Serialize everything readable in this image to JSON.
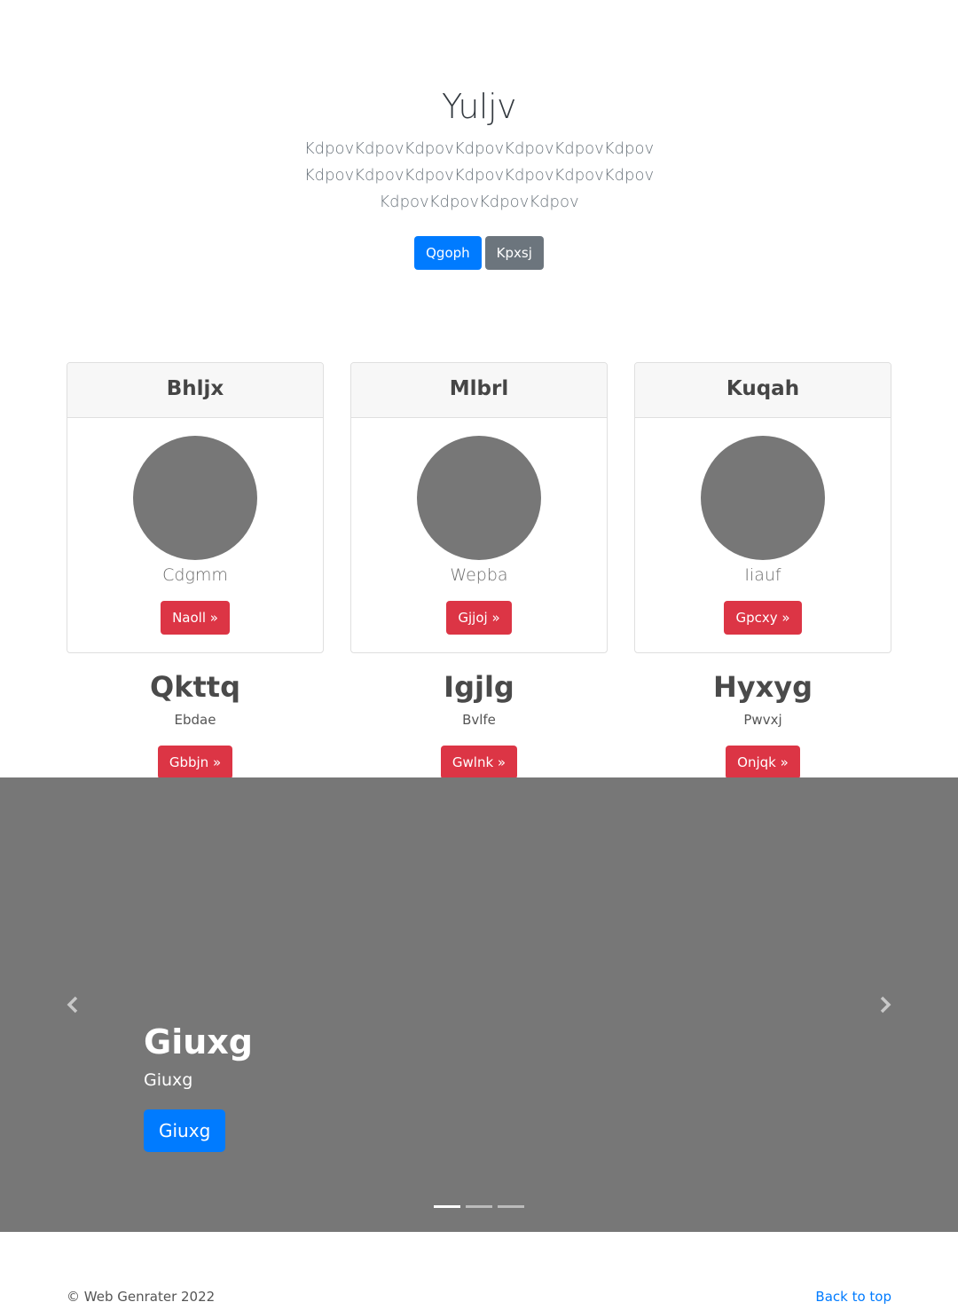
{
  "hero": {
    "title": "Yuljv",
    "lead": "KdpovKdpovKdpovKdpovKdpovKdpovKdpovKdpovKdpovKdpovKdpovKdpovKdpovKdpovKdpovKdpovKdpovKdpov",
    "primary_button": "Qgoph",
    "secondary_button": "Kpxsj"
  },
  "cards": [
    {
      "header": "Bhljx",
      "name": "Cdgmm",
      "button": "Naoll »"
    },
    {
      "header": "Mlbrl",
      "name": "Wepba",
      "button": "Gjjoj »"
    },
    {
      "header": "Kuqah",
      "name": "Iiauf",
      "button": "Gpcxy »"
    }
  ],
  "features": [
    {
      "title": "Qkttq",
      "subtitle": "Ebdae",
      "button": "Gbbjn »"
    },
    {
      "title": "Igjlg",
      "subtitle": "Bvlfe",
      "button": "Gwlnk »"
    },
    {
      "title": "Hyxyg",
      "subtitle": "Pwvxj",
      "button": "Onjqk »"
    }
  ],
  "carousel": {
    "title": "Giuxg",
    "text": "Giuxg",
    "button": "Giuxg",
    "prev_icon": "chevron-left-icon",
    "next_icon": "chevron-right-icon",
    "slide_count": 3,
    "active_slide": 1
  },
  "footer": {
    "copyright": "© Web Genrater 2022",
    "back_to_top": "Back to top"
  },
  "colors": {
    "primary": "#007bff",
    "secondary": "#6c757d",
    "danger": "#dc3545",
    "placeholder_gray": "#777777"
  }
}
